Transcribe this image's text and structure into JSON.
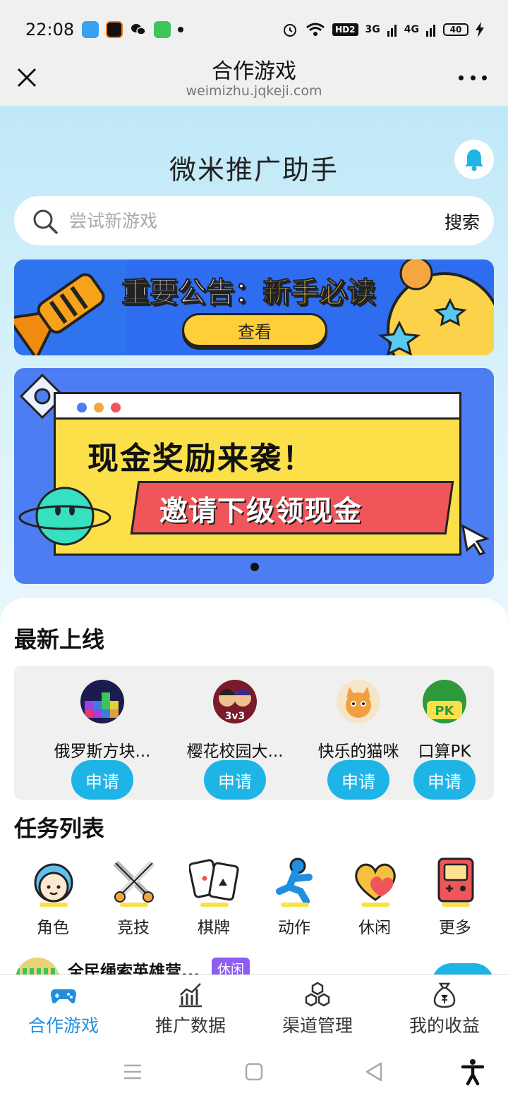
{
  "status_bar": {
    "time": "22:08",
    "network_badge": "HD2",
    "signal1": "3G",
    "signal2": "4G",
    "battery": "40"
  },
  "header": {
    "title": "合作游戏",
    "url": "weimizhu.jqkeji.com"
  },
  "app": {
    "title": "微米推广助手"
  },
  "search": {
    "placeholder": "尝试新游戏",
    "button_label": "搜索"
  },
  "banner1": {
    "title_part1": "重要公告：",
    "title_part2": "新手必读",
    "button_label": "查看"
  },
  "banner2": {
    "title": "现金奖励来袭！",
    "subtitle": "邀请下级领现金"
  },
  "newest": {
    "section_title": "最新上线",
    "games": [
      {
        "name": "俄罗斯方块...",
        "apply_label": "申请"
      },
      {
        "name": "樱花校园大...",
        "apply_label": "申请"
      },
      {
        "name": "快乐的猫咪",
        "apply_label": "申请"
      },
      {
        "name": "口算PK",
        "apply_label": "申请"
      }
    ]
  },
  "tasks": {
    "section_title": "任务列表",
    "categories": [
      {
        "label": "角色",
        "icon": "character-icon"
      },
      {
        "label": "竞技",
        "icon": "swords-icon"
      },
      {
        "label": "棋牌",
        "icon": "cards-icon"
      },
      {
        "label": "动作",
        "icon": "running-icon"
      },
      {
        "label": "休闲",
        "icon": "heart-icon"
      },
      {
        "label": "更多",
        "icon": "gameboy-icon"
      }
    ],
    "items": [
      {
        "name": "全民绳索英雄营...",
        "tag": "休闲"
      }
    ]
  },
  "bottom_nav": {
    "items": [
      {
        "label": "合作游戏",
        "icon": "gamepad-icon",
        "active": true
      },
      {
        "label": "推广数据",
        "icon": "chart-icon",
        "active": false
      },
      {
        "label": "渠道管理",
        "icon": "hexagons-icon",
        "active": false
      },
      {
        "label": "我的收益",
        "icon": "money-bag-icon",
        "active": false
      }
    ]
  },
  "colors": {
    "accent": "#1fb4e6",
    "nav_active": "#1f8fe0",
    "tag": "#8e5df2"
  }
}
